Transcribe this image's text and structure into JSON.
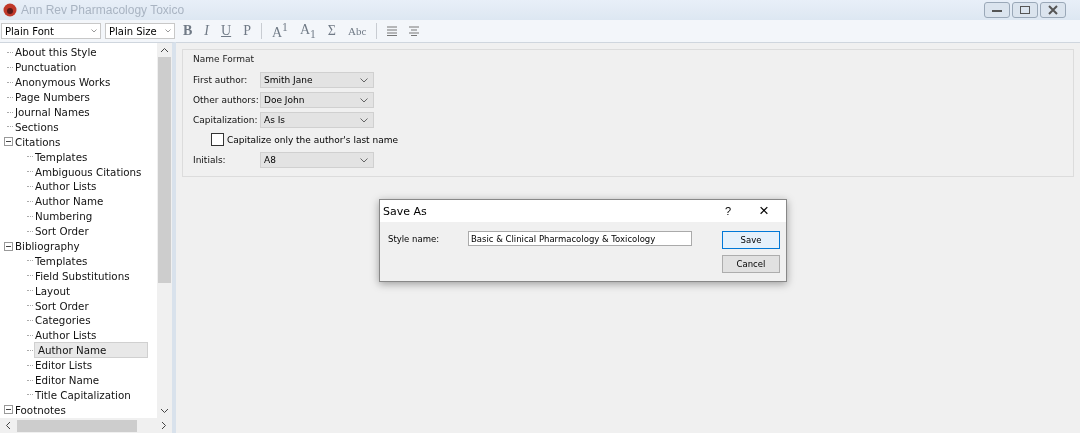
{
  "window": {
    "title": "Ann Rev Pharmacology Toxico"
  },
  "toolbar": {
    "font": "Plain Font",
    "size": "Plain Size",
    "format_buttons": [
      {
        "label": "B",
        "kind": "bold"
      },
      {
        "label": "I",
        "kind": "italic"
      },
      {
        "label": "U",
        "kind": "underline"
      },
      {
        "label": "P",
        "kind": "plain"
      },
      {
        "label": "A$^{1}$",
        "kind": "sep"
      },
      {
        "label": "A$_{1}$",
        "kind": "text"
      },
      {
        "label": "Σ",
        "kind": "text"
      },
      {
        "label": "Abc",
        "kind": "smallcaps"
      }
    ]
  },
  "tree": [
    {
      "label": "About this Style",
      "selected": false
    },
    {
      "label": "Punctuation",
      "selected": false
    },
    {
      "label": "Anonymous Works",
      "selected": false
    },
    {
      "label": "Page Numbers",
      "selected": false
    },
    {
      "label": "Journal Names",
      "selected": false
    },
    {
      "label": "Sections",
      "selected": false
    },
    {
      "label": "Citations",
      "selected": false,
      "expanded": true,
      "children": [
        {
          "label": "Templates",
          "selected": false
        },
        {
          "label": "Ambiguous Citations",
          "selected": false
        },
        {
          "label": "Author Lists",
          "selected": false
        },
        {
          "label": "Author Name",
          "selected": false
        },
        {
          "label": "Numbering",
          "selected": false
        },
        {
          "label": "Sort Order",
          "selected": false
        }
      ]
    },
    {
      "label": "Bibliography",
      "selected": false,
      "expanded": true,
      "children": [
        {
          "label": "Templates",
          "selected": false
        },
        {
          "label": "Field Substitutions",
          "selected": false
        },
        {
          "label": "Layout",
          "selected": false
        },
        {
          "label": "Sort Order",
          "selected": false
        },
        {
          "label": "Categories",
          "selected": false
        },
        {
          "label": "Author Lists",
          "selected": false
        },
        {
          "label": "Author Name",
          "selected": true
        },
        {
          "label": "Editor Lists",
          "selected": false
        },
        {
          "label": "Editor Name",
          "selected": false
        },
        {
          "label": "Title Capitalization",
          "selected": false
        }
      ]
    },
    {
      "label": "Footnotes",
      "selected": false,
      "expanded": true
    }
  ],
  "name_format": {
    "title": "Name Format",
    "fields": [
      {
        "label": "First author:",
        "value": "Smith Jane"
      },
      {
        "label": "Other authors:",
        "value": "Doe John"
      },
      {
        "label": "Capitalization:",
        "value": "As Is"
      }
    ],
    "checkbox": {
      "label": "Capitalize only the author's last name",
      "checked": false
    },
    "initials": {
      "label": "Initials:",
      "value": "A8"
    }
  },
  "dialog": {
    "title": "Save As",
    "help": "?",
    "close": "×",
    "field_label": "Style name:",
    "value": "Basic & Clinical Pharmacology & Toxicology",
    "buttons": [
      {
        "label": "Save",
        "default": true
      },
      {
        "label": "Cancel",
        "default": false
      }
    ]
  }
}
